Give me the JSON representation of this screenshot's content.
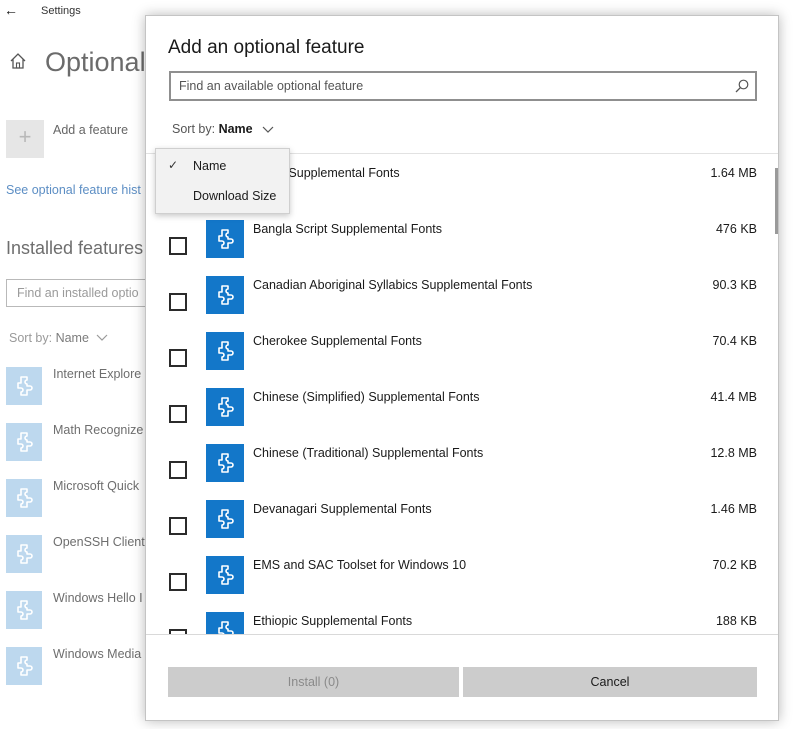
{
  "settings_window": {
    "app_title": "Settings",
    "page_title": "Optional",
    "add_feature_label": "Add a feature",
    "history_link": "See optional feature hist",
    "installed_heading": "Installed features",
    "installed_search_placeholder": "Find an installed optio",
    "sort_label": "Sort by:",
    "sort_value": "Name",
    "installed_items": [
      {
        "label": "Internet Explore"
      },
      {
        "label": "Math Recognize"
      },
      {
        "label": "Microsoft Quick"
      },
      {
        "label": "OpenSSH Client"
      },
      {
        "label": "Windows Hello I"
      },
      {
        "label": "Windows Media"
      }
    ]
  },
  "dialog": {
    "title": "Add an optional feature",
    "search_placeholder": "Find an available optional feature",
    "sort_label": "Sort by:",
    "sort_value": "Name",
    "features": [
      {
        "name": "Script Supplemental Fonts",
        "size": "1.64 MB"
      },
      {
        "name": "Bangla Script Supplemental Fonts",
        "size": "476 KB"
      },
      {
        "name": "Canadian Aboriginal Syllabics Supplemental Fonts",
        "size": "90.3 KB"
      },
      {
        "name": "Cherokee Supplemental Fonts",
        "size": "70.4 KB"
      },
      {
        "name": "Chinese (Simplified) Supplemental Fonts",
        "size": "41.4 MB"
      },
      {
        "name": "Chinese (Traditional) Supplemental Fonts",
        "size": "12.8 MB"
      },
      {
        "name": "Devanagari Supplemental Fonts",
        "size": "1.46 MB"
      },
      {
        "name": "EMS and SAC Toolset for Windows 10",
        "size": "70.2 KB"
      },
      {
        "name": "Ethiopic Supplemental Fonts",
        "size": "188 KB"
      }
    ],
    "install_button": "Install (0)",
    "cancel_button": "Cancel"
  },
  "sort_dropdown": {
    "options": [
      {
        "label": "Name",
        "selected": true
      },
      {
        "label": "Download Size",
        "selected": false
      }
    ],
    "check_glyph": "✓"
  },
  "colors": {
    "accent": "#1377c9",
    "accent_light": "#bdd8ee",
    "link": "#5c8ec4",
    "button_bg": "#cccccc"
  }
}
